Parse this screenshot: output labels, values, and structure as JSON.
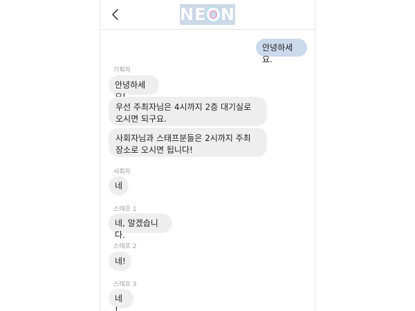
{
  "header": {
    "logo_text_left": "NE",
    "logo_text_right": "N",
    "back_icon": "chevron-left-icon"
  },
  "messages": [
    {
      "side": "out",
      "text": "안녕하세요."
    },
    {
      "sender": "기획자",
      "bubbles": [
        "안녕하세요!",
        "우선 주최자님은 4시까지 2층 대기실로 오시면 되구요.",
        "사회자님과 스태프분들은 2시까지 주최 장소로 오시면 됩니다!"
      ]
    },
    {
      "sender": "사회자",
      "bubbles": [
        "네"
      ]
    },
    {
      "sender": "스태프 1",
      "bubbles": [
        "네, 알겠습니다."
      ]
    },
    {
      "sender": "스태프 2",
      "bubbles": [
        "네!"
      ]
    },
    {
      "sender": "스태프 3",
      "bubbles": [
        "네 !"
      ]
    }
  ],
  "colors": {
    "outgoing_bubble": "#cbd9ec",
    "incoming_bubble": "#eeeeee",
    "logo_bg": "#cdd9e8"
  }
}
